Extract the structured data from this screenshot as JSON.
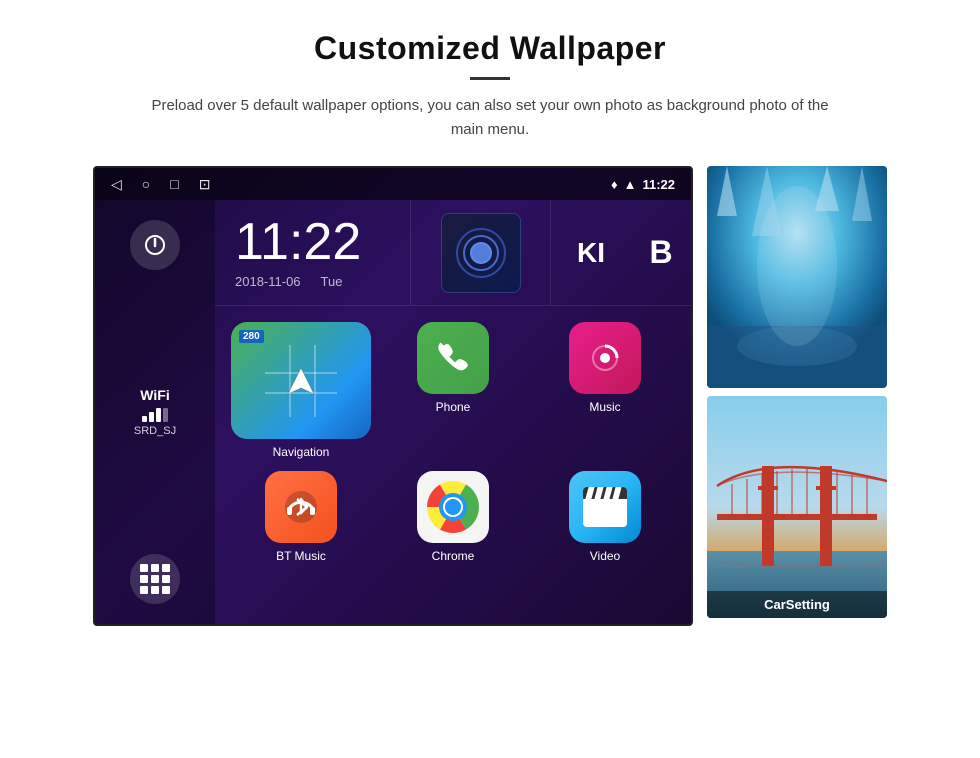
{
  "header": {
    "title": "Customized Wallpaper",
    "divider": "—",
    "subtitle": "Preload over 5 default wallpaper options, you can also set your own photo as background photo of the main menu."
  },
  "statusBar": {
    "navBack": "◁",
    "navHome": "○",
    "navRecent": "□",
    "navCamera": "⊡",
    "locationIcon": "♦",
    "wifiIcon": "▲",
    "time": "11:22"
  },
  "sidebar": {
    "powerButton": "⏻",
    "wifiLabel": "WiFi",
    "wifiSSID": "SRD_SJ",
    "appsButton": "⊞"
  },
  "clock": {
    "time": "11:22",
    "date": "2018-11-06",
    "day": "Tue"
  },
  "apps": [
    {
      "name": "Navigation",
      "type": "navigation"
    },
    {
      "name": "Phone",
      "type": "phone"
    },
    {
      "name": "Music",
      "type": "music"
    },
    {
      "name": "BT Music",
      "type": "btmusic"
    },
    {
      "name": "Chrome",
      "type": "chrome"
    },
    {
      "name": "Video",
      "type": "video"
    }
  ],
  "wallpapers": [
    {
      "name": "ice",
      "label": ""
    },
    {
      "name": "bridge",
      "label": "CarSetting"
    }
  ]
}
